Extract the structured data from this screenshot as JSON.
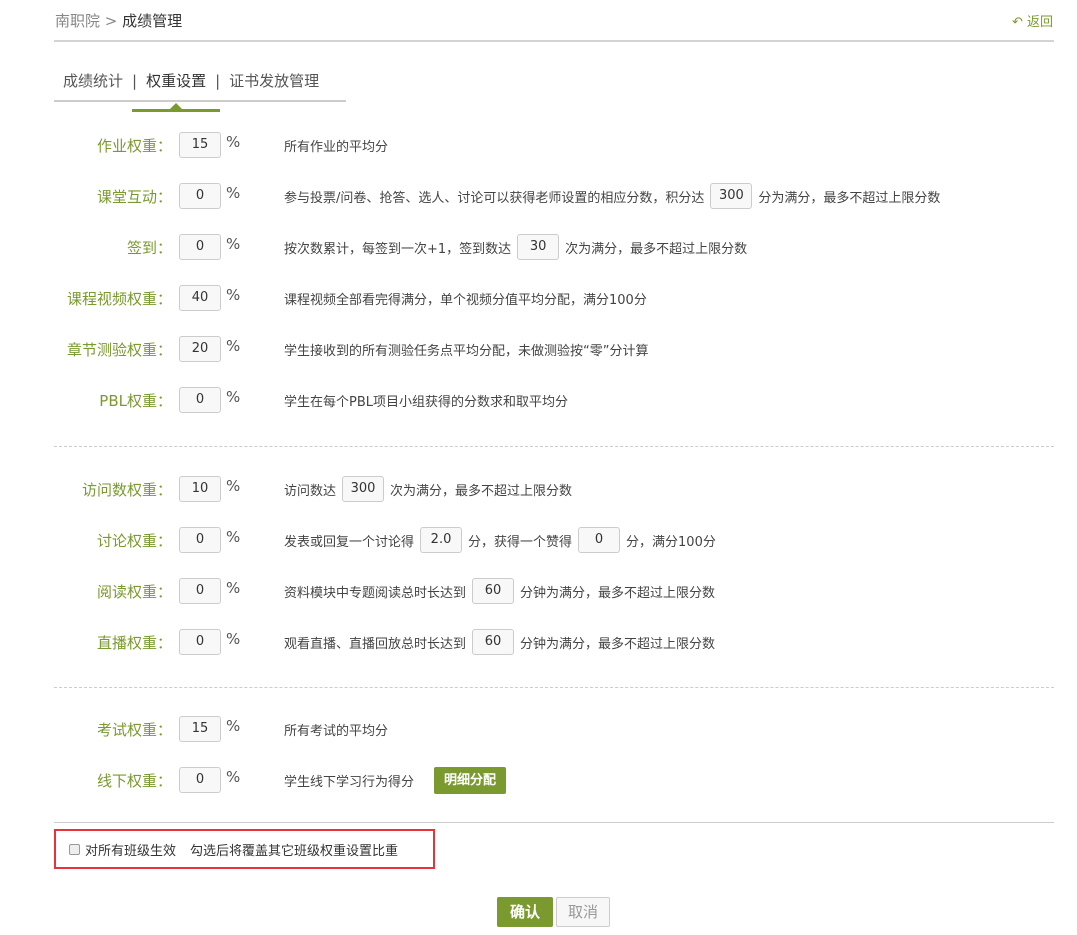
{
  "breadcrumb": {
    "root": "南职院",
    "sep": ">",
    "current": "成绩管理"
  },
  "back": "返回",
  "tabs": [
    "成绩统计",
    "权重设置",
    "证书发放管理"
  ],
  "tab_sep": "|",
  "rows": [
    {
      "label": "作业权重：",
      "value": "15",
      "desc": [
        "所有作业的平均分"
      ]
    },
    {
      "label": "课堂互动：",
      "value": "0",
      "desc": [
        "参与投票/问卷、抢答、选人、讨论可以获得老师设置的相应分数，积分达",
        "300",
        "分为满分，最多不超过上限分数"
      ]
    },
    {
      "label": "签到：",
      "value": "0",
      "desc": [
        "按次数累计，每签到一次+1，签到数达",
        "30",
        "次为满分，最多不超过上限分数"
      ]
    },
    {
      "label": "课程视频权重：",
      "value": "40",
      "desc": [
        "课程视频全部看完得满分，单个视频分值平均分配，满分100分"
      ]
    },
    {
      "label": "章节测验权重：",
      "value": "20",
      "desc": [
        "学生接收到的所有测验任务点平均分配，未做测验按“零”分计算"
      ]
    },
    {
      "label": "PBL权重：",
      "value": "0",
      "desc": [
        "学生在每个PBL项目小组获得的分数求和取平均分"
      ]
    },
    {
      "label": "访问数权重：",
      "value": "10",
      "desc": [
        "访问数达",
        "300",
        "次为满分，最多不超过上限分数"
      ]
    },
    {
      "label": "讨论权重：",
      "value": "0",
      "desc": [
        "发表或回复一个讨论得",
        "2.0",
        "分，获得一个赞得",
        "0",
        "分，满分100分"
      ]
    },
    {
      "label": "阅读权重：",
      "value": "0",
      "desc": [
        "资料模块中专题阅读总时长达到",
        "60",
        "分钟为满分，最多不超过上限分数"
      ]
    },
    {
      "label": "直播权重：",
      "value": "0",
      "desc": [
        "观看直播、直播回放总时长达到",
        "60",
        "分钟为满分，最多不超过上限分数"
      ]
    },
    {
      "label": "考试权重：",
      "value": "15",
      "desc": [
        "所有考试的平均分"
      ]
    },
    {
      "label": "线下权重：",
      "value": "0",
      "desc": [
        "学生线下学习行为得分"
      ],
      "button": "明细分配"
    }
  ],
  "percent": "%",
  "apply_all": {
    "label": "对所有班级生效",
    "hint": "勾选后将覆盖其它班级权重设置比重",
    "checked": false
  },
  "confirm": "确认",
  "cancel": "取消",
  "accent": "#7a9a2f"
}
